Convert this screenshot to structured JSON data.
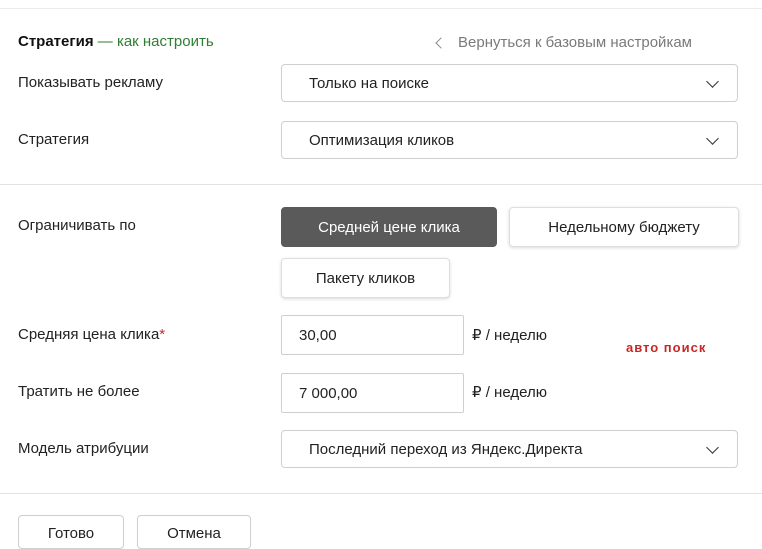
{
  "header": {
    "title": "Стратегия",
    "dash": " — ",
    "help_link": "как настроить",
    "back_link": "Вернуться к базовым настройкам"
  },
  "fields": {
    "show_ads": {
      "label": "Показывать рекламу",
      "value": "Только на поиске"
    },
    "strategy": {
      "label": "Стратегия",
      "value": "Оптимизация кликов"
    },
    "limit_by": {
      "label": "Ограничивать по",
      "options": [
        "Средней цене клика",
        "Недельному бюджету",
        "Пакету кликов"
      ],
      "selected": "Средней цене клика"
    },
    "avg_cpc": {
      "label": "Средняя цена клика",
      "required_mark": "*",
      "value": "30,00",
      "unit": "₽ / неделю"
    },
    "spend_limit": {
      "label": "Тратить не более",
      "value": "7 000,00",
      "unit": "₽ / неделю"
    },
    "attribution": {
      "label": "Модель атрибуции",
      "value": "Последний переход из Яндекс.Директа"
    }
  },
  "annotation": "авто поиск",
  "footer": {
    "ok_label": "Готово",
    "cancel_label": "Отмена"
  },
  "colors": {
    "link_green": "#2e7d32",
    "active_segment": "#5a5a5a",
    "required_red": "#c62828"
  }
}
